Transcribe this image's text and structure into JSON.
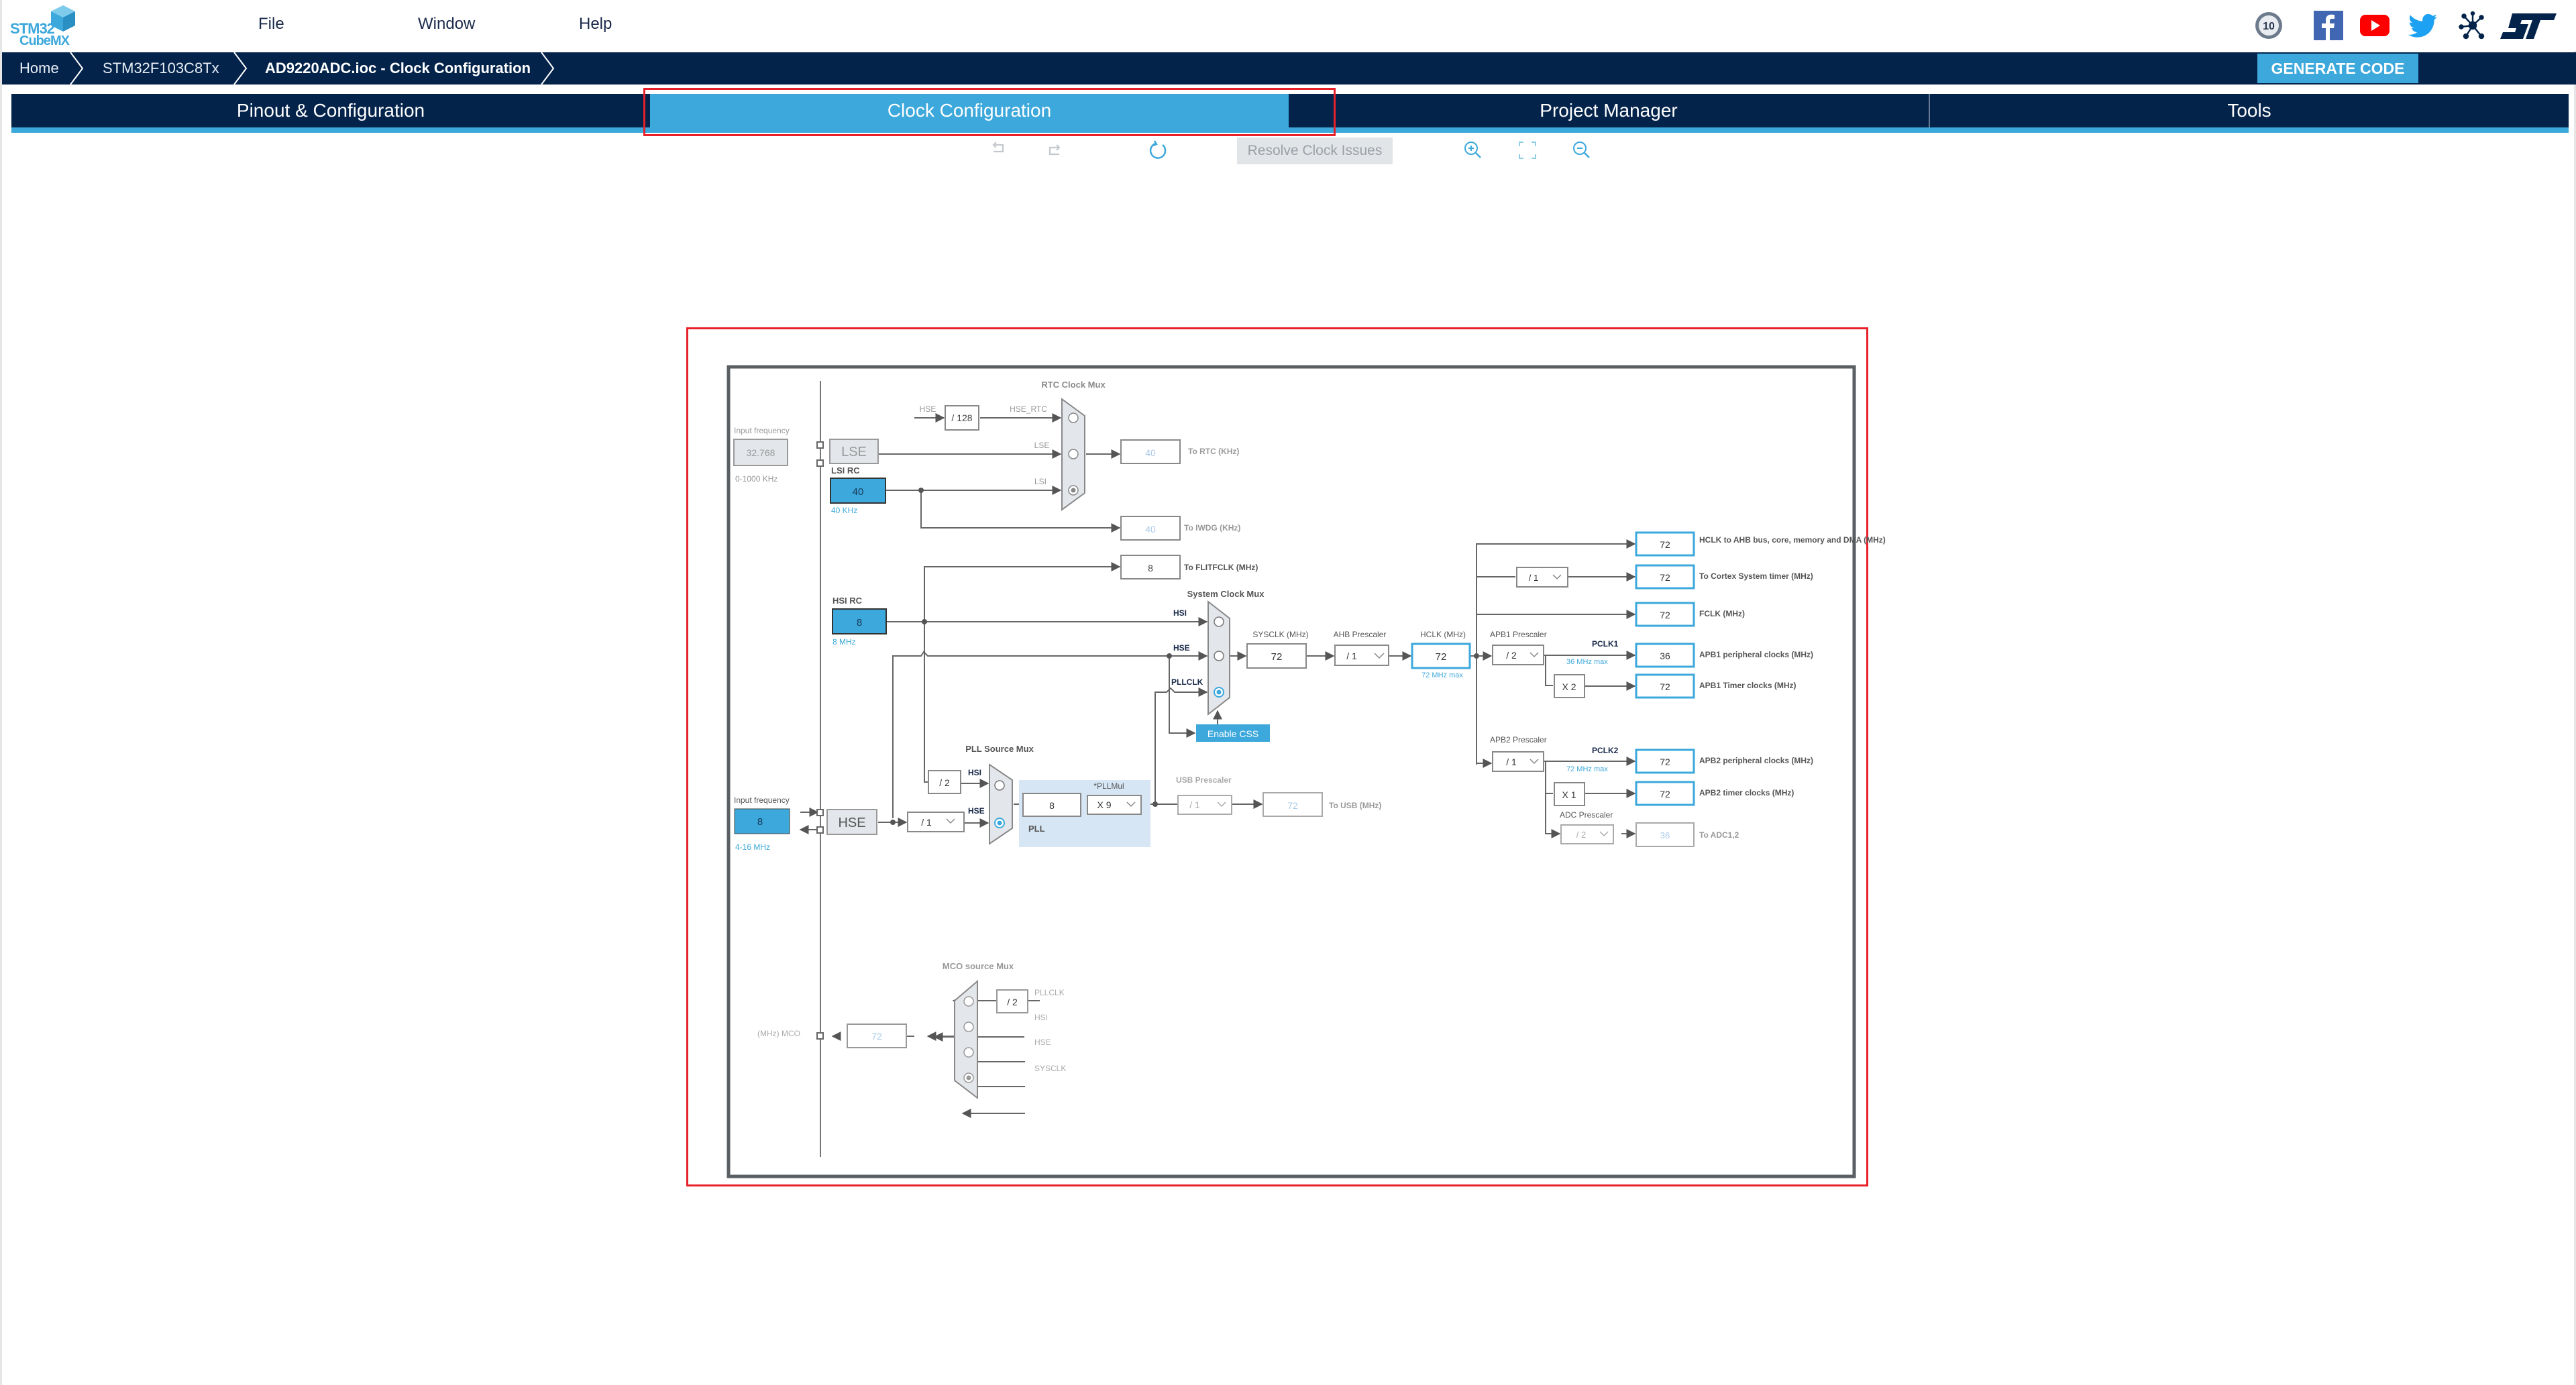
{
  "app": {
    "logo_line1": "STM32",
    "logo_line2": "CubeMX",
    "menu": [
      "File",
      "Window",
      "Help"
    ],
    "social_icons": [
      "anniversary-10-years-icon",
      "facebook-icon",
      "youtube-icon",
      "twitter-icon",
      "network-icon",
      "st-logo-icon"
    ]
  },
  "breadcrumb": [
    "Home",
    "STM32F103C8Tx",
    "AD9220ADC.ioc - Clock Configuration"
  ],
  "generate_code_label": "GENERATE CODE",
  "tabs": [
    {
      "label": "Pinout & Configuration",
      "active": false
    },
    {
      "label": "Clock Configuration",
      "active": true
    },
    {
      "label": "Project Manager",
      "active": false
    },
    {
      "label": "Tools",
      "active": false
    }
  ],
  "toolbar": {
    "undo": "undo-icon",
    "redo": "redo-icon",
    "reset": "refresh-icon",
    "resolve_label": "Resolve Clock Issues",
    "zoom_in": "zoom-in-icon",
    "fit": "fit-to-screen-icon",
    "zoom_out": "zoom-out-icon"
  },
  "colors": {
    "navy": "#03234b",
    "accent": "#3ca8db",
    "highlight_red": "#e8202a",
    "pll_bg": "#d6e6f4",
    "mux_fill": "#e3e6ea"
  },
  "diagram": {
    "lse_input": {
      "label": "Input frequency",
      "value": "32.768",
      "range": "0-1000 KHz",
      "block": "LSE"
    },
    "lsi": {
      "label": "LSI RC",
      "value": "40",
      "unit": "40 KHz"
    },
    "hsi": {
      "label": "HSI RC",
      "value": "8",
      "unit": "8 MHz"
    },
    "hse_input": {
      "label": "Input frequency",
      "value": "8",
      "range": "4-16 MHz",
      "block": "HSE"
    },
    "rtc_mux": {
      "title": "RTC Clock Mux",
      "hse_label": "HSE",
      "div": "/ 128",
      "hse_rtc": "HSE_RTC",
      "lse": "LSE",
      "lsi": "LSI",
      "selected": "LSI"
    },
    "to_rtc": {
      "value": "40",
      "label": "To RTC (KHz)"
    },
    "to_iwdg": {
      "value": "40",
      "label": "To IWDG (KHz)"
    },
    "to_flitfclk": {
      "value": "8",
      "label": "To FLITFCLK (MHz)"
    },
    "sysclk_mux": {
      "title": "System Clock Mux",
      "hsi": "HSI",
      "hse": "HSE",
      "pllclk": "PLLCLK",
      "selected": "PLLCLK"
    },
    "enable_css": "Enable CSS",
    "pll_source_mux": {
      "title": "PLL Source Mux",
      "hsi": "HSI",
      "hse": "HSE",
      "hsi_div": "/ 2",
      "selected": "HSE"
    },
    "hse_prediv": "/ 1",
    "pll": {
      "label": "PLL",
      "input": "8",
      "mul_label": "*PLLMul",
      "mul": "X 9"
    },
    "usb": {
      "title": "USB Prescaler",
      "div": "/ 1",
      "value": "72",
      "label": "To USB (MHz)"
    },
    "sysclk": {
      "label": "SYSCLK (MHz)",
      "value": "72"
    },
    "ahb": {
      "label": "AHB Prescaler",
      "div": "/ 1"
    },
    "hclk": {
      "label": "HCLK (MHz)",
      "value": "72",
      "max": "72 MHz max"
    },
    "outputs": [
      {
        "value": "72",
        "label": "HCLK to AHB bus, core, memory and DMA (MHz)"
      },
      {
        "value": "72",
        "label": "To Cortex System timer (MHz)",
        "div": "/ 1"
      },
      {
        "value": "72",
        "label": "FCLK (MHz)"
      },
      {
        "value": "36",
        "label": "APB1 peripheral clocks (MHz)"
      },
      {
        "value": "72",
        "label": "APB1 Timer clocks (MHz)"
      },
      {
        "value": "72",
        "label": "APB2 peripheral clocks (MHz)"
      },
      {
        "value": "72",
        "label": "APB2 timer clocks (MHz)"
      }
    ],
    "apb1": {
      "label": "APB1 Prescaler",
      "div": "/ 2",
      "pclk": "PCLK1",
      "max": "36 MHz max",
      "timer_mul": "X 2"
    },
    "apb2": {
      "label": "APB2 Prescaler",
      "div": "/ 1",
      "pclk": "PCLK2",
      "max": "72 MHz max",
      "timer_mul": "X 1"
    },
    "adc": {
      "label": "ADC Prescaler",
      "div": "/ 2",
      "value": "36",
      "out_label": "To ADC1,2"
    },
    "mco": {
      "title": "MCO source Mux",
      "label": "(MHz) MCO",
      "value": "72",
      "div": "/ 2",
      "sources": [
        "PLLCLK",
        "HSI",
        "HSE",
        "SYSCLK"
      ],
      "selected": "SYSCLK"
    }
  }
}
